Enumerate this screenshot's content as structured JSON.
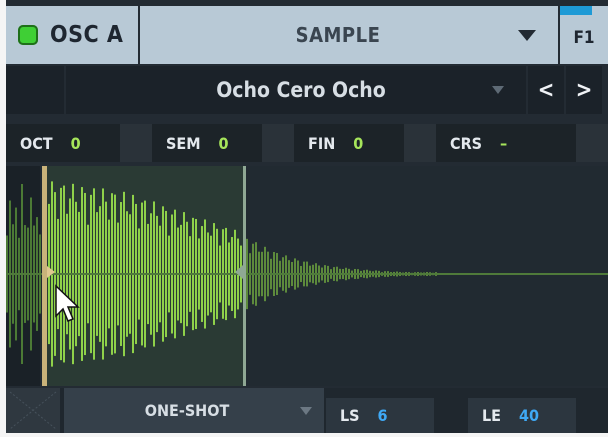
{
  "header": {
    "osc_label": "OSC A",
    "source_label": "SAMPLE",
    "filter_label": "F1"
  },
  "preset": {
    "name": "Ocho Cero Ocho",
    "prev_glyph": "<",
    "next_glyph": ">"
  },
  "params": [
    {
      "key": "OCT",
      "value": "0"
    },
    {
      "key": "SEM",
      "value": "0"
    },
    {
      "key": "FIN",
      "value": "0"
    },
    {
      "key": "CRS",
      "value": "–"
    }
  ],
  "bottom": {
    "mode": "ONE-SHOT",
    "loop_start_key": "LS",
    "loop_start_value": "6",
    "loop_end_key": "LE",
    "loop_end_value": "40"
  },
  "colors": {
    "accent_green": "#a6e55b",
    "accent_blue": "#3fa9f5",
    "led_green": "#3fcf35",
    "header_bg": "#b8c9d6"
  },
  "icons": [
    "power-led",
    "dropdown-arrow-icon",
    "chevron-left-icon",
    "chevron-right-icon",
    "mouse-cursor-icon",
    "start-marker-icon",
    "end-marker-icon"
  ]
}
